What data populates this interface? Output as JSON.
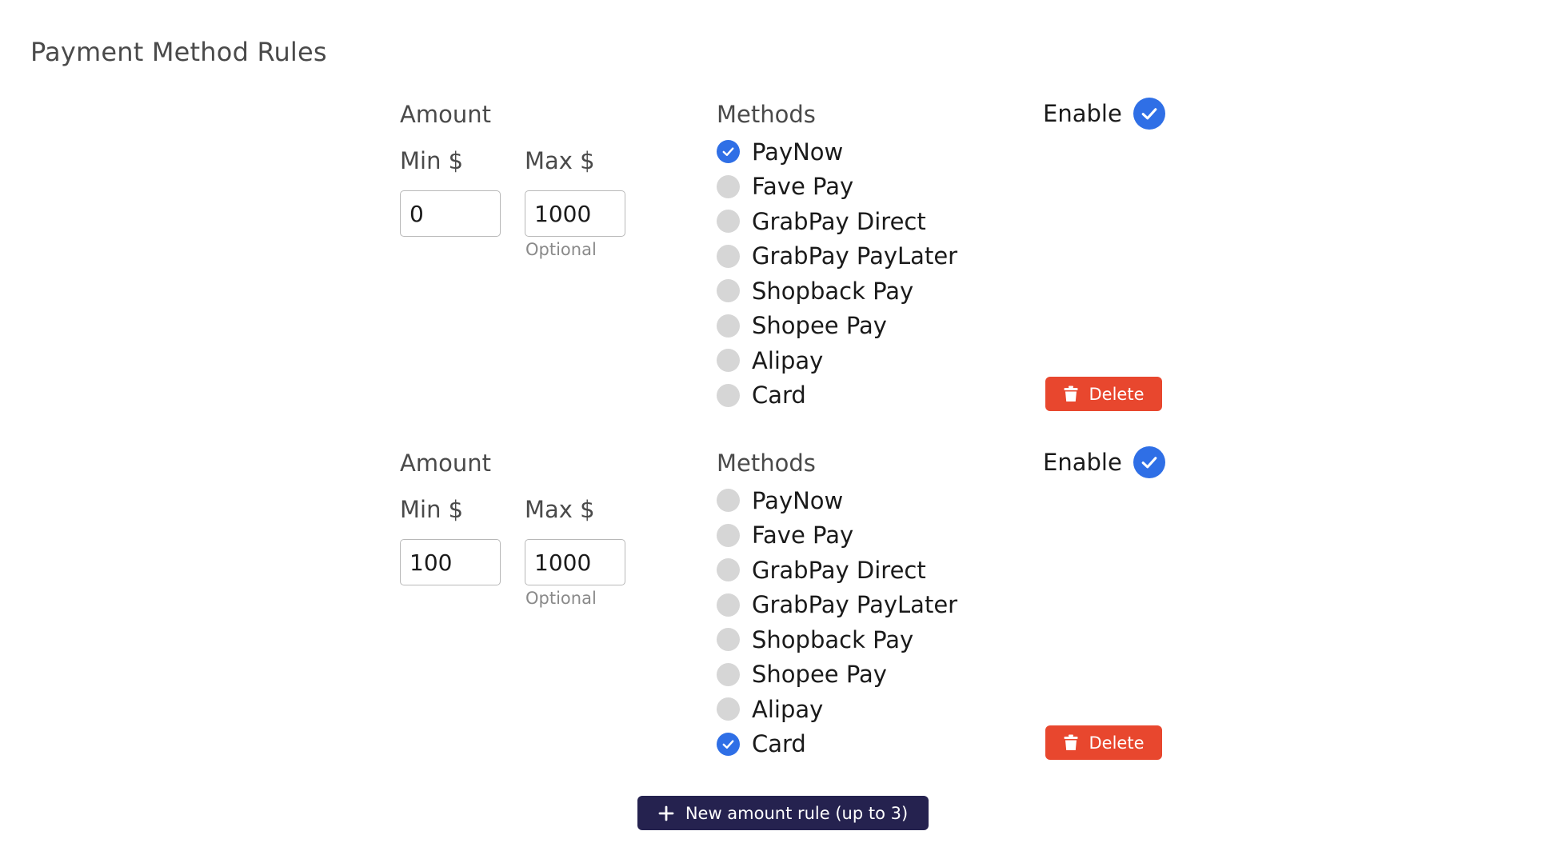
{
  "page": {
    "title": "Payment Method Rules"
  },
  "labels": {
    "amount": "Amount",
    "min": "Min $",
    "max": "Max $",
    "optional": "Optional",
    "methods": "Methods",
    "enable": "Enable",
    "delete": "Delete"
  },
  "rules": [
    {
      "min": "0",
      "max": "1000",
      "enabled": true,
      "methods": [
        {
          "label": "PayNow",
          "checked": true
        },
        {
          "label": "Fave Pay",
          "checked": false
        },
        {
          "label": "GrabPay Direct",
          "checked": false
        },
        {
          "label": "GrabPay PayLater",
          "checked": false
        },
        {
          "label": "Shopback Pay",
          "checked": false
        },
        {
          "label": "Shopee Pay",
          "checked": false
        },
        {
          "label": "Alipay",
          "checked": false
        },
        {
          "label": "Card",
          "checked": false
        }
      ]
    },
    {
      "min": "100",
      "max": "1000",
      "enabled": true,
      "methods": [
        {
          "label": "PayNow",
          "checked": false
        },
        {
          "label": "Fave Pay",
          "checked": false
        },
        {
          "label": "GrabPay Direct",
          "checked": false
        },
        {
          "label": "GrabPay PayLater",
          "checked": false
        },
        {
          "label": "Shopback Pay",
          "checked": false
        },
        {
          "label": "Shopee Pay",
          "checked": false
        },
        {
          "label": "Alipay",
          "checked": false
        },
        {
          "label": "Card",
          "checked": true
        }
      ]
    }
  ],
  "actions": {
    "new_rule_label": "New amount rule (up to 3)"
  },
  "colors": {
    "accent": "#2f6fe6",
    "danger": "#e8472e",
    "primary_button": "#25224f",
    "radio_off": "#d6d6d6"
  },
  "icons": {
    "check": "check-icon",
    "trash": "trash-icon",
    "plus": "plus-icon"
  }
}
